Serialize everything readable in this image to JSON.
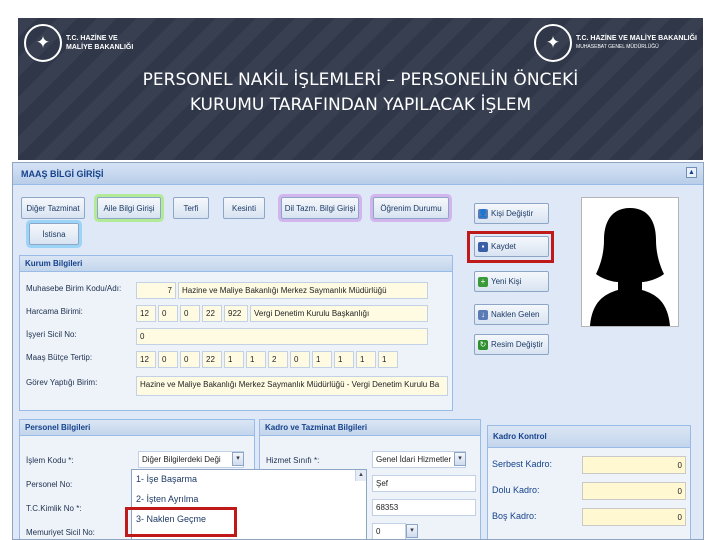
{
  "banner": {
    "left_logo": {
      "line1": "T.C. HAZİNE VE",
      "line2": "MALİYE BAKANLIĞI"
    },
    "right_logo": {
      "line1": "T.C. HAZİNE VE MALİYE BAKANLIĞI",
      "line2": "MUHASEBAT GENEL MÜDÜRLÜĞÜ"
    },
    "title_line1": "PERSONEL NAKİL İŞLEMLERİ – PERSONELİN ÖNCEKİ",
    "title_line2": "KURUMU TARAFINDAN YAPILACAK İŞLEM"
  },
  "app": {
    "title": "MAAŞ BİLGİ GİRİŞİ",
    "collapse_glyph": "▲",
    "tabs": [
      {
        "label": "Diğer Tazminat"
      },
      {
        "label": "Aile Bilgi Girişi"
      },
      {
        "label": "Terfi"
      },
      {
        "label": "Kesinti"
      },
      {
        "label": "Dil Tazm. Bilgi Girişi"
      },
      {
        "label": "Öğrenim Durumu"
      },
      {
        "label": "İstisna"
      }
    ],
    "side_buttons": [
      {
        "label": "Kişi Değiştir",
        "icon": "user-icon",
        "glyph": "👤",
        "color": "#5a7bb5"
      },
      {
        "label": "Kaydet",
        "icon": "floppy-disk-icon",
        "glyph": "▪",
        "color": "#3b5ea8"
      },
      {
        "label": "Yeni Kişi",
        "icon": "new-user-icon",
        "glyph": "+",
        "color": "#3a9a3a"
      },
      {
        "label": "Naklen Gelen",
        "icon": "incoming-user-icon",
        "glyph": "↓",
        "color": "#5a7bb5"
      },
      {
        "label": "Resim Değiştir",
        "icon": "refresh-icon",
        "glyph": "↻",
        "color": "#2e8f2e"
      }
    ],
    "kurum": {
      "title": "Kurum Bilgileri",
      "muhasebe_label": "Muhasebe Birim Kodu/Adı:",
      "muhasebe_code": "7",
      "muhasebe_name": "Hazine ve Maliye Bakanlığı Merkez Saymanlık Müdürlüğü",
      "harcama_label": "Harcama Birimi:",
      "harcama_codes": [
        "12",
        "0",
        "0",
        "22",
        "922"
      ],
      "harcama_name": "Vergi Denetim Kurulu Başkanlığı",
      "ilk_sicil_label": "İşyeri Sicil No:",
      "ilk_sicil_value": "0",
      "butce_label": "Maaş Bütçe Tertip:",
      "butce_codes": [
        "12",
        "0",
        "0",
        "22",
        "1",
        "1",
        "2",
        "0",
        "1",
        "1",
        "1",
        "1"
      ],
      "gorev_label": "Görev Yaptığı Birim:",
      "gorev_value": "Hazine ve Maliye Bakanlığı Merkez Saymanlık Müdürlüğü - Vergi Denetim Kurulu Ba"
    },
    "personel": {
      "title": "Personel Bilgileri",
      "islem_label": "İşlem Kodu *:",
      "islem_value": "Diğer Bilgilerdeki Deği",
      "personel_no_label": "Personel No:",
      "tc_label": "T.C.Kimlik No *:",
      "memuriyet_label": "Memuriyet Sicil No:",
      "options": [
        "1- İşe Başarma",
        "2- İşten Ayrılma",
        "3- Naklen Geçme"
      ]
    },
    "kadro": {
      "title": "Kadro ve Tazminat Bilgileri",
      "hizmet_label": "Hizmet Sınıfı *:",
      "hizmet_value": "Genel İdari Hizmetler",
      "unvan_value": "Şef",
      "value_2": "68353",
      "value_3": "0"
    },
    "kadro_kontrol": {
      "title": "Kadro Kontrol",
      "rows": [
        {
          "label": "Serbest Kadro:",
          "value": "0"
        },
        {
          "label": "Dolu Kadro:",
          "value": "0"
        },
        {
          "label": "Boş Kadro:",
          "value": "0"
        }
      ]
    }
  },
  "colors": {
    "banner": "#31394a",
    "highlight": "#c01919"
  }
}
